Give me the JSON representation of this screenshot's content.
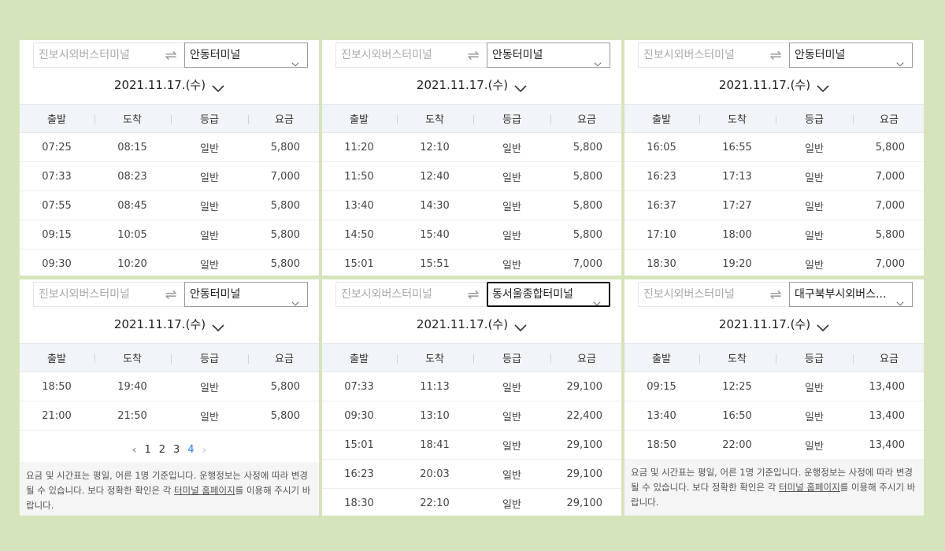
{
  "common": {
    "origin_placeholder": "진보시외버스터미널",
    "date": "2021.11.17.(수)",
    "headers": [
      "출발",
      "도착",
      "등급",
      "요금"
    ],
    "notice_before": "요금 및 시간표는 평일, 어른 1명 기준입니다. 운행정보는 사정에 따라 변경될 수 있습니다. 보다 정확한 확인은 각 ",
    "notice_link": "터미널 홈페이지",
    "notice_after": "를 이용해 주시기 바랍니다."
  },
  "panels": [
    {
      "destination": "안동터미널",
      "rows": [
        [
          "07:25",
          "08:15",
          "일반",
          "5,800"
        ],
        [
          "07:33",
          "08:23",
          "일반",
          "7,000"
        ],
        [
          "07:55",
          "08:45",
          "일반",
          "5,800"
        ],
        [
          "09:15",
          "10:05",
          "일반",
          "5,800"
        ],
        [
          "09:30",
          "10:20",
          "일반",
          "5,800"
        ]
      ]
    },
    {
      "destination": "안동터미널",
      "rows": [
        [
          "11:20",
          "12:10",
          "일반",
          "5,800"
        ],
        [
          "11:50",
          "12:40",
          "일반",
          "5,800"
        ],
        [
          "13:40",
          "14:30",
          "일반",
          "5,800"
        ],
        [
          "14:50",
          "15:40",
          "일반",
          "5,800"
        ],
        [
          "15:01",
          "15:51",
          "일반",
          "7,000"
        ]
      ]
    },
    {
      "destination": "안동터미널",
      "rows": [
        [
          "16:05",
          "16:55",
          "일반",
          "5,800"
        ],
        [
          "16:23",
          "17:13",
          "일반",
          "7,000"
        ],
        [
          "16:37",
          "17:27",
          "일반",
          "7,000"
        ],
        [
          "17:10",
          "18:00",
          "일반",
          "5,800"
        ],
        [
          "18:30",
          "19:20",
          "일반",
          "7,000"
        ]
      ]
    },
    {
      "destination": "안동터미널",
      "rows": [
        [
          "18:50",
          "19:40",
          "일반",
          "5,800"
        ],
        [
          "21:00",
          "21:50",
          "일반",
          "5,800"
        ]
      ],
      "pagination": [
        "1",
        "2",
        "3",
        "4"
      ],
      "current_page": "4"
    },
    {
      "destination": "동서울종합터미널",
      "rows": [
        [
          "07:33",
          "11:13",
          "일반",
          "29,100"
        ],
        [
          "09:30",
          "13:10",
          "일반",
          "22,400"
        ],
        [
          "15:01",
          "18:41",
          "일반",
          "29,100"
        ],
        [
          "16:23",
          "20:03",
          "일반",
          "29,100"
        ],
        [
          "18:30",
          "22:10",
          "일반",
          "29,100"
        ]
      ]
    },
    {
      "destination": "대구북부시외버스...",
      "rows": [
        [
          "09:15",
          "12:25",
          "일반",
          "13,400"
        ],
        [
          "13:40",
          "16:50",
          "일반",
          "13,400"
        ],
        [
          "18:50",
          "22:00",
          "일반",
          "13,400"
        ]
      ]
    }
  ]
}
